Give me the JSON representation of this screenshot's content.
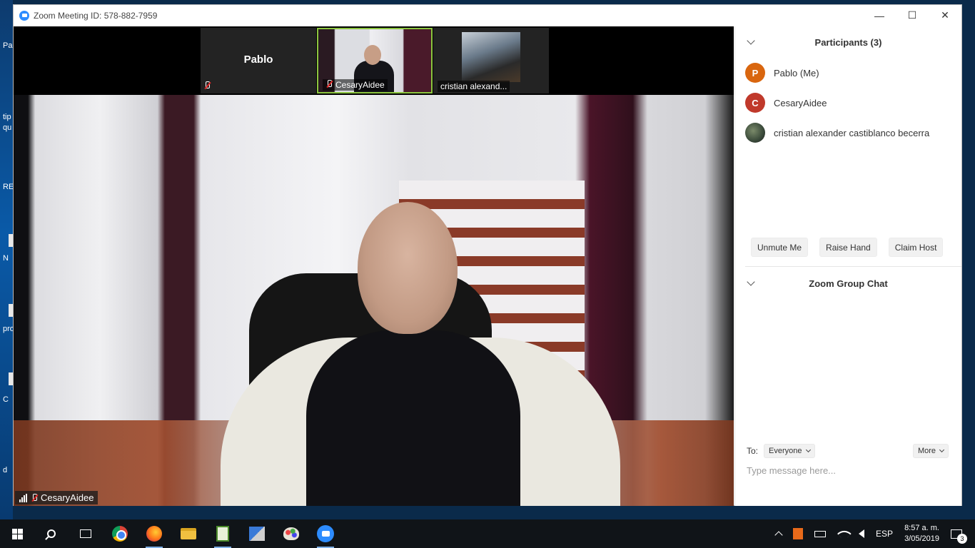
{
  "window": {
    "title": "Zoom Meeting ID: 578-882-7959"
  },
  "desktop_fragments": [
    "Pa",
    "tip",
    "qu",
    "RE",
    "N",
    "pro",
    "C",
    "d"
  ],
  "thumbnails": [
    {
      "name": "Pablo",
      "label": ""
    },
    {
      "name": "",
      "label": "CesaryAidee"
    },
    {
      "name": "",
      "label": "cristian alexand..."
    }
  ],
  "main_video": {
    "speaker_label": "CesaryAidee"
  },
  "participants": {
    "title": "Participants (3)",
    "list": [
      {
        "initial": "P",
        "name": "Pablo (Me)",
        "color": "#d9660f"
      },
      {
        "initial": "C",
        "name": "CesaryAidee",
        "color": "#c0392b"
      },
      {
        "initial": "",
        "name": "cristian alexander castiblanco becerra",
        "color": ""
      }
    ],
    "buttons": {
      "unmute": "Unmute Me",
      "raise_hand": "Raise Hand",
      "claim_host": "Claim Host"
    }
  },
  "chat": {
    "title": "Zoom Group Chat",
    "to_label": "To:",
    "to_value": "Everyone",
    "more_label": "More",
    "placeholder": "Type message here..."
  },
  "taskbar": {
    "language": "ESP",
    "time": "8:57 a. m.",
    "date": "3/05/2019",
    "notifications": "3"
  },
  "colors": {
    "accent": "#2d8cff",
    "active_border": "#8cc63f",
    "muted_red": "#e02828"
  }
}
